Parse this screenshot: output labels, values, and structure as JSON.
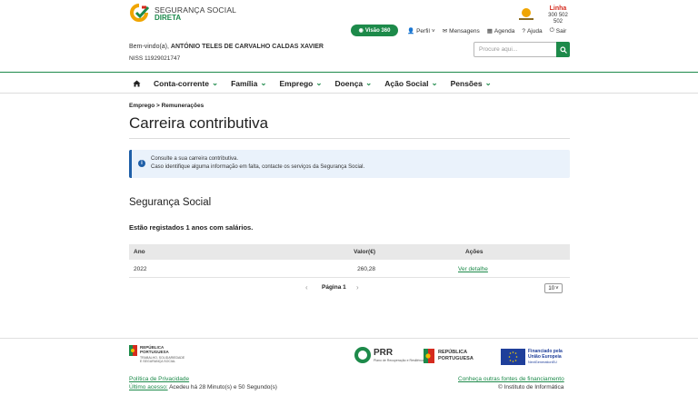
{
  "header": {
    "logo_line1": "SEGURANÇA SOCIAL",
    "logo_line2": "DIRETA",
    "linha_line1": "Linha",
    "linha_line2": "300 502 502",
    "via_label": "Visão 360",
    "links": {
      "perfil": "Perfil",
      "mensagens": "Mensagens",
      "agenda": "Agenda",
      "ajuda": "Ajuda",
      "sair": "Sair"
    },
    "welcome_prefix": "Bem-vindo(a),",
    "user_name": "ANTÓNIO TELES DE CARVALHO CALDAS XAVIER",
    "niss": "NISS 11929021747",
    "search_placeholder": "Procure aqui..."
  },
  "nav": {
    "items": [
      "Conta-corrente",
      "Família",
      "Emprego",
      "Doença",
      "Ação Social",
      "Pensões"
    ]
  },
  "breadcrumb": "Emprego > Remunerações",
  "page_title": "Carreira contributiva",
  "info": {
    "line1": "Consulte a sua carreira contributiva.",
    "line2": "Caso identifique alguma informação em falta, contacte os serviços da Segurança Social."
  },
  "section_title": "Segurança Social",
  "years_text": "Estão registados 1 anos com salários.",
  "table": {
    "headers": {
      "ano": "Ano",
      "valor": "Valor(€)",
      "acoes": "Ações"
    },
    "rows": [
      {
        "ano": "2022",
        "valor": "260,28",
        "acao": "Ver detalhe"
      }
    ]
  },
  "pagination": {
    "label": "Página 1",
    "per_page": "10"
  },
  "footer": {
    "rp_line1": "REPÚBLICA",
    "rp_line2": "PORTUGUESA",
    "rp_sub1": "TRABALHO, SOLIDARIEDADE",
    "rp_sub2": "E SEGURANÇA SOCIAL",
    "prr": "PRR",
    "prr_sub": "Plano de Recuperação e Resiliência",
    "rp2_line1": "REPÚBLICA",
    "rp2_line2": "PORTUGUESA",
    "eu_line1": "Financiado pela",
    "eu_line2": "União Europeia",
    "eu_sub": "NextGenerationEU",
    "privacy": "Política de Privacidade",
    "last_access_label": "Último acesso:",
    "last_access_value": " Acedeu há 28 Minuto(s) e 50 Segundo(s)",
    "funding": "Conheça outras fontes de financiamento",
    "institute": "© Instituto de Informática"
  },
  "colors": {
    "brand_green": "#1d8a4a",
    "info_blue": "#1f5fa8"
  }
}
